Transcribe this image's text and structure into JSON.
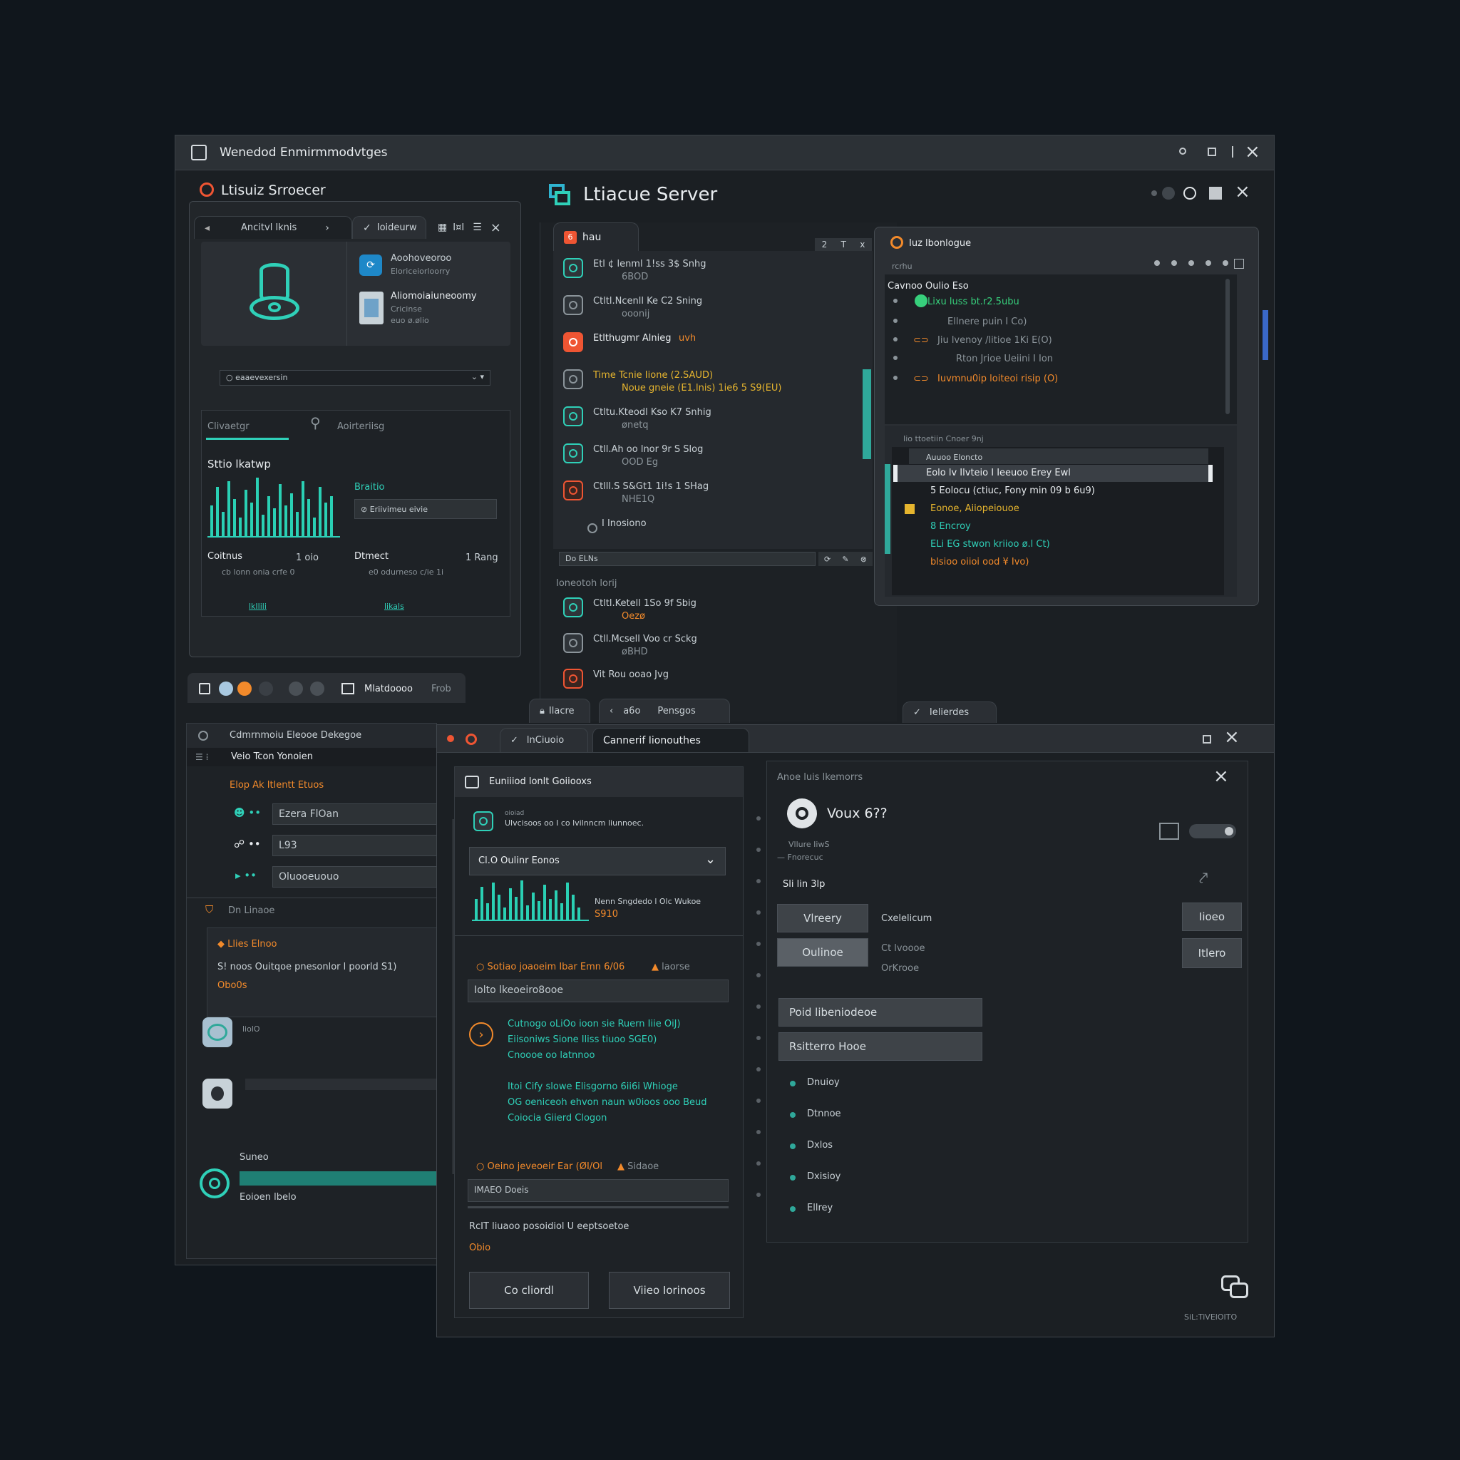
{
  "main_window": {
    "title": "Wenedod Enmirmmodvtges"
  },
  "left_panel": {
    "title": "Ltisuiz Srroecer",
    "tabs": [
      "Ancitvl lknis",
      "Ioideurw",
      "I¤I"
    ],
    "cards": [
      {
        "title": "Aoohoveoroo",
        "subtitle": "Eloriceiorloorry"
      },
      {
        "title": "Aliomoiaiuneoomy",
        "subtitle": "Cricinse",
        "meta": "euo ø.ølio"
      }
    ],
    "dropdown": "eaaevexersin",
    "subtabs": [
      "Clivaetgr",
      "Aoirteriisg"
    ],
    "section_title": "Sttio lkatwp",
    "brand_label": "Braitio",
    "brand_field": "Eriivimeu eivie",
    "stats": [
      {
        "label": "Coitnus",
        "value": "1 oio",
        "sub": "cb lonn onia crfe 0"
      },
      {
        "label": "Dtmect",
        "value": "1 Rang",
        "sub": "e0 odurneso c/ie 1i"
      }
    ],
    "footer_links": [
      "lkIlili",
      "likals"
    ]
  },
  "server_window": {
    "title": "Ltiacue Server",
    "list_tab": "hau",
    "list_header_icons": [
      "2",
      "T",
      "x"
    ],
    "items": [
      {
        "line1": "Etl  ¢  lenml  1!ss  3$ Snhg",
        "line2": "6BOD",
        "icon": "teal"
      },
      {
        "line1": "Ctltl.Ncenll  Ke  C2 Sning",
        "line2": "ooonij",
        "icon": "grey"
      },
      {
        "line1": "Etlthugmr  Alnieg",
        "line2": "",
        "icon": "orange-fill",
        "accent": "uvh"
      },
      {
        "line1": "Time  Tcnie  Iione  (2.SAUD)",
        "line2": "Noue gneie  (E1.lnis)   1ie6  5  S9(EU)",
        "icon": "grey",
        "yellow": true
      },
      {
        "line1": "Ctltu.Kteodl  Kso  K7  Snhig",
        "line2": "ønetq",
        "icon": "teal"
      },
      {
        "line1": "Ctll.Ah  oo  lnor  9r   S  Slog",
        "line2": "OOD Eg",
        "icon": "teal"
      },
      {
        "line1": "Ctlll.S  S&Gt1  1i!s  1  SHag",
        "line2": "NHE1Q",
        "icon": "red"
      },
      {
        "line1": "I Inosiono",
        "line2": "",
        "icon": "none"
      }
    ],
    "list_footer": "Do ELNs",
    "section2_label": "Ioneotoh lorij",
    "items2": [
      {
        "line1": "Ctltl.Ketell  1So  9f  Sbig",
        "line2": "Oezø",
        "icon": "teal",
        "orange2": true
      },
      {
        "line1": "Ctll.Mcsell  Voo  cr  Sckg",
        "line2": "øBHD",
        "icon": "grey"
      },
      {
        "line1": "Vit  Rou  ooao  Jvg",
        "line2": "",
        "icon": "red"
      }
    ],
    "bottom_tabs": [
      "Ilacre",
      "a6o",
      "Pensgos",
      "Ielierdes"
    ]
  },
  "right_panel": {
    "title": "Iuz lbonlogue",
    "subtitle": "rcrhu",
    "header": "Cavnoo Oulio Eso",
    "items": [
      {
        "text": "Lixu  luss   bt.r2.5ubu",
        "color": "green"
      },
      {
        "text": "Ellnere  puin  I  Co)",
        "color": "grey"
      },
      {
        "text": "Jiu  lvenoy  /litioe  1Ki  E(O)",
        "color": "grey"
      },
      {
        "text": "Rton  Jrioe  Ueiini  I  Ion",
        "color": "grey"
      },
      {
        "text": "Iuvmnu0ip  loiteoi  risip   (O)",
        "color": "orange"
      }
    ],
    "console_header": "Iio  ttoetiin  Cnoer  9nj",
    "console_tab": "Auuoo  Eloncto",
    "console_lines": [
      {
        "text": "Eolo  lv  Ilvteio  I  Ieeuoo  Erey  Ewl",
        "color": "white",
        "selected": true
      },
      {
        "text": "5  Eolocu  (ctiuc,  Fony  min  09 b  6u9)",
        "color": "white"
      },
      {
        "text": "Eonoe,      Aiiopeiouoe",
        "color": "yellow"
      },
      {
        "text": "8  Encroy",
        "color": "teal"
      },
      {
        "text": "ELi  EG  stwon  kriioo  ø.l  Ct)",
        "color": "teal"
      },
      {
        "text": "blsioo  oiioi  ood  ¥  Ivo)",
        "color": "orange"
      }
    ]
  },
  "lower_left": {
    "tab_label": "Mlatdoooo",
    "tab_sub": "Frob",
    "header": "Cdmrnmoiu  Eleooe  Dekegoe",
    "subheader": "Veio  Tcon  Yonoien",
    "section_title": "Elop  Ak  Itlentt  Etuos",
    "fields": [
      "Ezera  FlOan",
      "L93",
      "Oluooeuouo"
    ],
    "section2": "Dn  Linaoe",
    "card_title": "Llies  Elnoo",
    "card_text": "S!  noos  Ouitqoe  pnesonlor  l  poorld  S1)",
    "card_value": "Obo0s",
    "item_label": "liolO",
    "status_label": "Suneo",
    "status_text": "Eoioen  lbelo"
  },
  "bottom_window": {
    "tabs": [
      "lnCiuoio",
      "Cannerif  Iionouthes"
    ],
    "form": {
      "header": "Euniiiod  lonlt  Goiiooxs",
      "desc_small": "oioiad",
      "desc": "Ulvcisoos  oo  I  co  lvilnncm  liunnoec.",
      "select": "Cl.O Oulinr  Eonos",
      "chart_text": "Nenn  Sngdedo  l  Olc  Wukoe",
      "chart_value": "S910",
      "step1": "Sotiao  joaoeim  Ibar  Emn  6/06",
      "step1_tag": "laorse",
      "field1": "Iolto  lkeoeiro8ooe",
      "info_lines": [
        "Cutnogo  oLiOo  ioon  sie  Ruern  Iiie  OiJ)",
        "Eiisoniws  Sione  Iliss  tiuoo  SGE0)",
        "Cnoooe  oo  latnnoo"
      ],
      "info_lines2": [
        "Itoi  Cify   slowe  Elisgorno  6ii6i  Whioge",
        "OG  oeniceoh  ehvon  naun  w0ioos  ooo  Beud",
        "Coiocia  Giierd  Clogon"
      ],
      "step2": "Oeino  jeveoeir  Ear  (ØI/Ol",
      "step2_tag": "Sidaoe",
      "field2": "IMAEO  Doeis",
      "note": "RcIT  liuaoo  posoidiol  U  eeptsoetoe",
      "note_value": "Obio",
      "buttons": [
        "Co  cliordl",
        "Viieo  Iorinoos"
      ]
    },
    "detail": {
      "header": "Anoe  luis  lkemorrs",
      "name": "Voux  6??",
      "meta1": "Vllure  IiwS",
      "meta2": "— Fnorecuc",
      "section": "Sli  lin  3lp",
      "buttons_left": [
        "Vlreery",
        "Oulinoe"
      ],
      "labels": [
        "Cxelelicum",
        "Ct  lvoooe",
        "OrKrooe"
      ],
      "buttons_right": [
        "Iioeo",
        "Itlero"
      ],
      "bars": [
        "Poid  libeniodeoe",
        "Rsitterro  Hooe"
      ],
      "list": [
        "Dnuioy",
        "Dtnnoe",
        "Dxlos",
        "Dxisioy",
        "Ellrey"
      ],
      "corner_label": "SiL:TiVElOITO"
    }
  },
  "colors": {
    "accent": "#2fd0b8",
    "alert": "#ef5533",
    "warn": "#f28a2b",
    "bg": "#10161c"
  }
}
